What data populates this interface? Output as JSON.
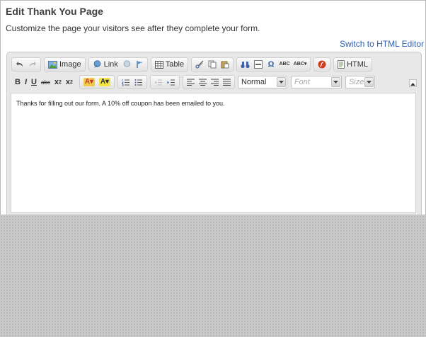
{
  "page": {
    "title": "Edit Thank You Page",
    "subtitle": "Customize the page your visitors see after they complete your form.",
    "switch_link": "Switch to HTML Editor"
  },
  "toolbar": {
    "undo_icon": "undo-icon",
    "redo_icon": "redo-icon",
    "image_label": "Image",
    "link_label": "Link",
    "table_label": "Table",
    "html_label": "HTML",
    "bold": "B",
    "italic": "I",
    "underline": "U",
    "strike": "abc",
    "subscript": "x",
    "subscript_index": "2",
    "superscript": "x",
    "superscript_index": "2",
    "format_value": "Normal",
    "font_placeholder": "Font",
    "size_placeholder": "Size"
  },
  "editor": {
    "content": "Thanks for filling out our form. A 10% off coupon has been emailed to you."
  },
  "colors": {
    "link": "#2b5fb4",
    "title": "#404040",
    "backdrop": "#c9c9c9"
  }
}
